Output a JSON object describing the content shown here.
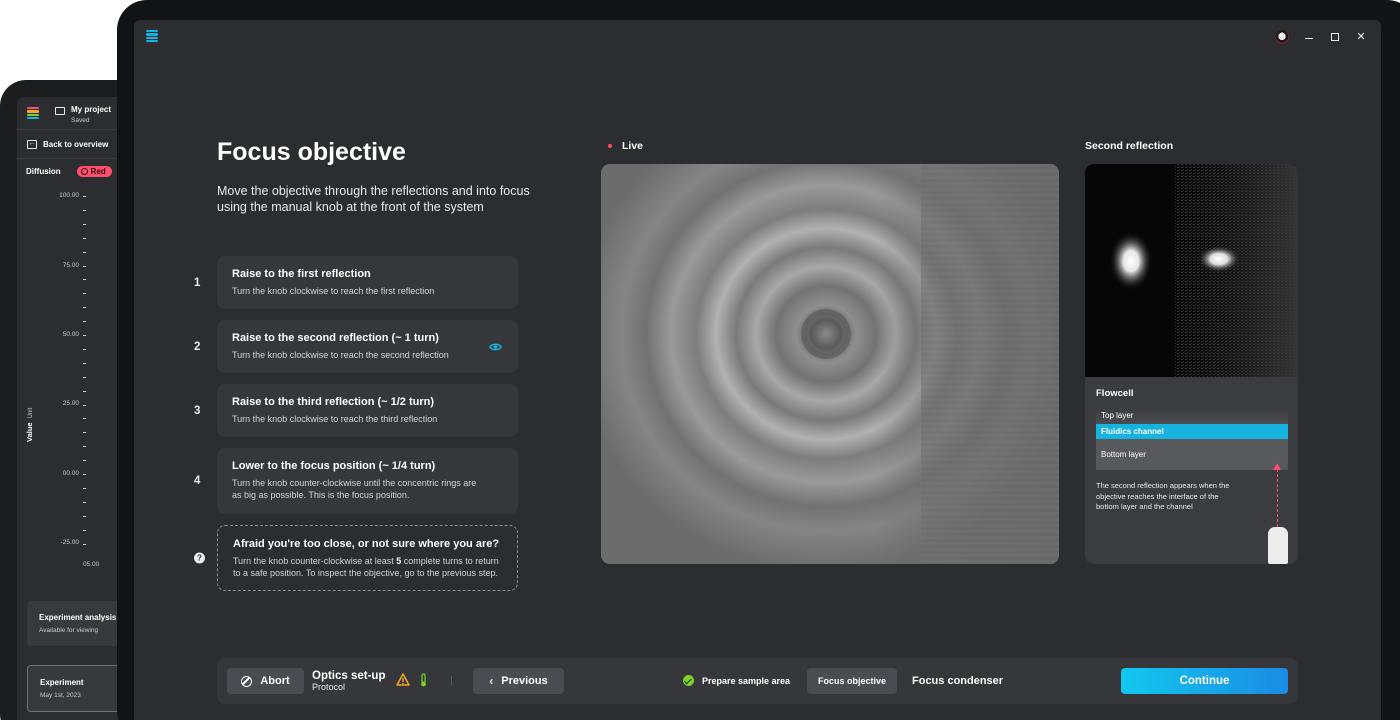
{
  "back_app": {
    "project_title": "My project",
    "project_status": "Saved",
    "back_link": "Back to overview",
    "section_label": "Diffusion",
    "pill_label": "Red",
    "y_ticks": [
      "100.00",
      "75.00",
      "50.00",
      "25.00",
      "00.00",
      "-25.00"
    ],
    "y_axis_label": "Value",
    "y_axis_unit": "Unit",
    "x_tick": "05.00",
    "cards": [
      {
        "title": "Experiment analysis",
        "subtitle": "Available for viewing"
      },
      {
        "title": "Experiment",
        "subtitle": "May 1st, 2023"
      }
    ]
  },
  "app": {
    "title": "Focus objective",
    "description": "Move the objective through the reflections and into focus using the manual knob at the front of the system",
    "steps": [
      {
        "number": "1",
        "title": "Raise to the first reflection",
        "subtitle": "Turn the knob clockwise to reach the first reflection"
      },
      {
        "number": "2",
        "title": "Raise to the second reflection (~ 1 turn)",
        "subtitle": "Turn the knob clockwise to reach the second reflection"
      },
      {
        "number": "3",
        "title": "Raise to the third reflection (~ 1/2 turn)",
        "subtitle": "Turn the knob clockwise to reach the third reflection"
      },
      {
        "number": "4",
        "title": "Lower to the focus position (~ 1/4 turn)",
        "subtitle": "Turn the knob counter-clockwise until the concentric rings are as big as possible. This is the focus position."
      }
    ],
    "help": {
      "icon": "?",
      "title": "Afraid you're too close, or not sure where you are?",
      "subtitle_before": "Turn the knob counter-clockwise at least ",
      "subtitle_bold": "5",
      "subtitle_after": " complete turns to return to a safe position. To inspect the objective, go to the previous step."
    },
    "live_label": "Live",
    "second_reflection_label": "Second reflection",
    "flowcell": {
      "title": "Flowcell",
      "layers": [
        "Top layer",
        "Fluidics channel",
        "Bottom layer"
      ],
      "note": "The second reflection appears when the objective reaches the interface of the bottom layer and the channel"
    },
    "toolbar": {
      "abort_label": "Abort",
      "protocol_title": "Optics set-up",
      "protocol_sub": "Protocol",
      "previous_label": "Previous",
      "steps": [
        "Prepare sample area",
        "Focus objective",
        "Focus condenser"
      ],
      "continue_label": "Continue"
    },
    "colors": {
      "accent": "#16b3e0",
      "live_dot": "#ff4d6d",
      "done": "#7ed321",
      "warning": "#f5a623"
    }
  }
}
